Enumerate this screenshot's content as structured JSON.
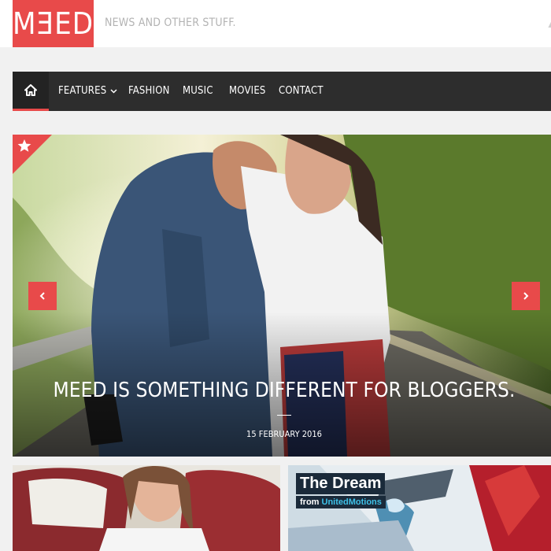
{
  "header": {
    "logo_text": "MƎED",
    "tagline": "NEWS AND OTHER STUFF."
  },
  "nav": {
    "items": [
      {
        "label": "FEATURES",
        "has_dropdown": true
      },
      {
        "label": "FASHION"
      },
      {
        "label": "MUSIC"
      },
      {
        "label": "MOVIES"
      },
      {
        "label": "CONTACT"
      }
    ]
  },
  "hero": {
    "title": "MEED IS SOMETHING DIFFERENT FOR BLOGGERS.",
    "date": "15 FEBRUARY 2016"
  },
  "cards": {
    "right": {
      "title": "The Dream",
      "subtitle_prefix": "from",
      "subtitle_brand": "UnitedMotions"
    }
  },
  "colors": {
    "accent": "#e84a4a",
    "nav_bg": "#2d2d2d",
    "page_bg": "#f1f1f1"
  },
  "icons": {
    "home": "home-icon",
    "star": "star-icon",
    "prev": "chevron-left-icon",
    "next": "chevron-right-icon",
    "dropdown": "chevron-down-icon"
  }
}
